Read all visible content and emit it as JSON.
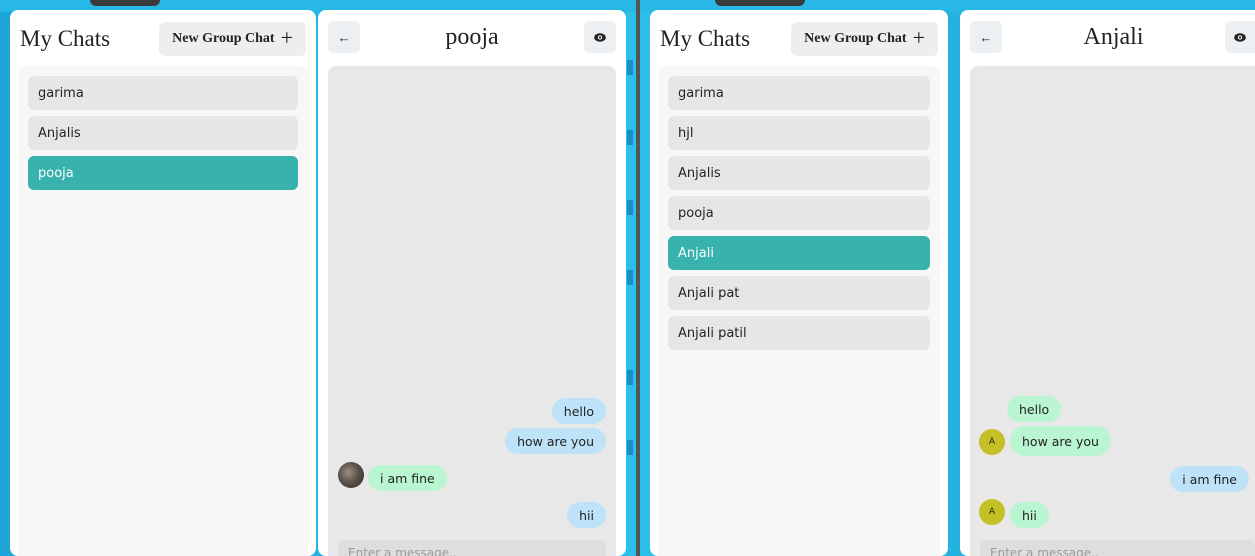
{
  "left_app": {
    "chats": {
      "title": "My Chats",
      "new_group_label": "New Group Chat",
      "items": [
        "garima",
        "Anjalis",
        "pooja"
      ],
      "selected": "pooja"
    },
    "conversation": {
      "back_icon": "arrow-left-icon",
      "title": "pooja",
      "view_icon": "eye-icon",
      "messages": [
        {
          "text": "hello",
          "direction": "outgoing"
        },
        {
          "text": "how are you",
          "direction": "outgoing"
        },
        {
          "text": "i am fine",
          "direction": "incoming",
          "avatar": "photo"
        },
        {
          "text": "hii",
          "direction": "outgoing"
        }
      ],
      "input_placeholder": "Enter a message.."
    }
  },
  "right_app": {
    "chats": {
      "title": "My Chats",
      "new_group_label": "New Group Chat",
      "items": [
        "garima",
        "hjl",
        "Anjalis",
        "pooja",
        "Anjali",
        "Anjali pat",
        "Anjali patil"
      ],
      "selected": "Anjali"
    },
    "conversation": {
      "back_icon": "arrow-left-icon",
      "title": "Anjali",
      "view_icon": "eye-icon",
      "messages": [
        {
          "text": "hello",
          "direction": "incoming"
        },
        {
          "text": "how are you",
          "direction": "incoming",
          "avatar": "A"
        },
        {
          "text": "i am fine",
          "direction": "outgoing"
        },
        {
          "text": "hii",
          "direction": "incoming",
          "avatar": "A"
        }
      ],
      "input_placeholder": "Enter a message.."
    }
  },
  "colors": {
    "selected_chat": "#38b2ac",
    "outgoing_bubble": "#bee3f8",
    "incoming_bubble": "#b9f5d0",
    "background": "#27b8e6",
    "avatar_initial": "#c5c026"
  }
}
